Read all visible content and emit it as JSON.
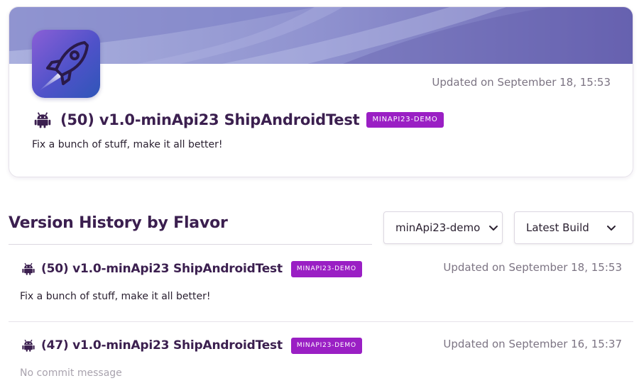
{
  "featured": {
    "updated": "Updated on September 18, 15:53",
    "title": "(50) v1.0-minApi23 ShipAndroidTest",
    "badge": "MINAPI23-DEMO",
    "message": "Fix a bunch of stuff, make it all better!",
    "platform_icon": "android-icon",
    "app_icon": "rocket-icon"
  },
  "history": {
    "title": "Version History by Flavor",
    "flavor_select": {
      "value": "minApi23-demo"
    },
    "build_select": {
      "value": "Latest Build"
    },
    "rows": [
      {
        "title": "(50) v1.0-minApi23 ShipAndroidTest",
        "badge": "MINAPI23-DEMO",
        "updated": "Updated on September 18, 15:53",
        "message": "Fix a bunch of stuff, make it all better!"
      },
      {
        "title": "(47) v1.0-minApi23 ShipAndroidTest",
        "badge": "MINAPI23-DEMO",
        "updated": "Updated on September 16, 15:37",
        "message": "No commit message"
      }
    ]
  },
  "colors": {
    "accent": "#9a1fc4",
    "title": "#3b1f4f",
    "muted": "#7c7483",
    "banner_light": "#a7aedc",
    "banner_dark": "#6d69b6"
  }
}
